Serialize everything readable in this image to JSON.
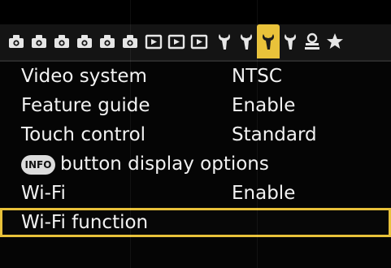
{
  "colors": {
    "background": "#050505",
    "text": "#f2f2f2",
    "accent": "#e8c13a",
    "tabbar_bg": "#141414"
  },
  "tabs": [
    {
      "icon": "shooting-camera-icon",
      "active": false
    },
    {
      "icon": "shooting-camera-icon",
      "active": false
    },
    {
      "icon": "shooting-camera-icon",
      "active": false
    },
    {
      "icon": "shooting-camera-icon",
      "active": false
    },
    {
      "icon": "shooting-camera-icon",
      "active": false
    },
    {
      "icon": "shooting-camera-icon",
      "active": false
    },
    {
      "icon": "playback-icon",
      "active": false
    },
    {
      "icon": "playback-icon",
      "active": false
    },
    {
      "icon": "playback-icon",
      "active": false
    },
    {
      "icon": "setup-wrench-icon",
      "active": false
    },
    {
      "icon": "setup-wrench-icon",
      "active": false
    },
    {
      "icon": "setup-wrench-icon",
      "active": true
    },
    {
      "icon": "setup-wrench-icon",
      "active": false
    },
    {
      "icon": "custom-functions-icon",
      "active": false
    },
    {
      "icon": "my-menu-star-icon",
      "active": false
    }
  ],
  "menu": {
    "items": [
      {
        "label": "Video system",
        "value": "NTSC"
      },
      {
        "label": "Feature guide",
        "value": "Enable"
      },
      {
        "label": "Touch control",
        "value": "Standard"
      },
      {
        "label": "button display options",
        "badge": "INFO",
        "value": ""
      },
      {
        "label": "Wi-Fi",
        "value": "Enable"
      },
      {
        "label": "Wi-Fi function",
        "value": "",
        "selected": true
      }
    ]
  }
}
